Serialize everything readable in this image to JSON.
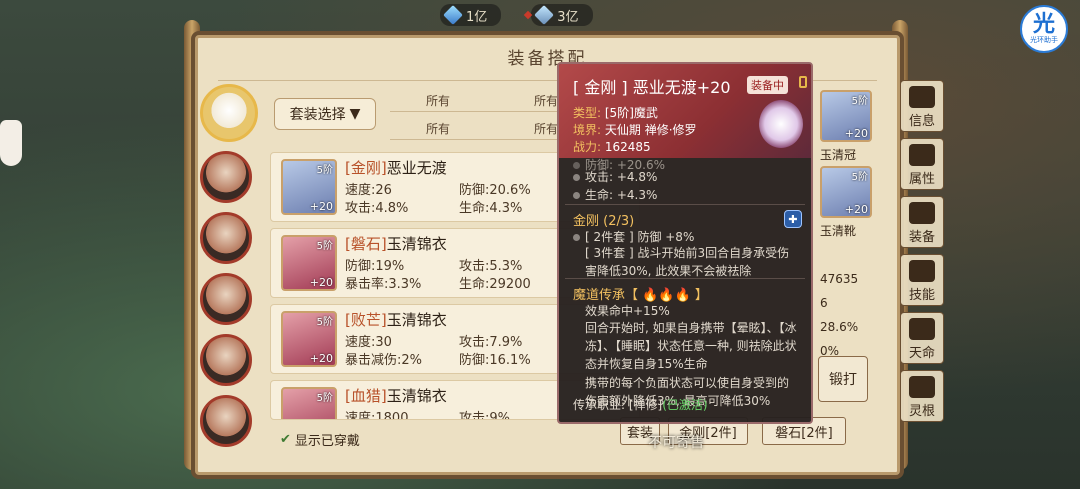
{
  "currency": {
    "jade": "1亿",
    "spirit_stone": "3亿"
  },
  "logo": {
    "big": "光",
    "small": "光环助手"
  },
  "panel": {
    "title": "装备搭配"
  },
  "filters": {
    "suit_select": "套装选择",
    "filter_all": "所有"
  },
  "rows": [
    {
      "tag": "[金刚]",
      "name": "恶业无渡",
      "tier": "5阶",
      "plus": "+20",
      "s1": "速度:26",
      "s2": "防御:20.6%",
      "s3": "攻击:4.8%",
      "s4": "生命:4.3%"
    },
    {
      "tag": "[磐石]",
      "name": "玉清锦衣",
      "tier": "5阶",
      "plus": "+20",
      "s1": "防御:19%",
      "s2": "攻击:5.3%",
      "s3": "暴击率:3.3%",
      "s4": "生命:29200"
    },
    {
      "tag": "[败芒]",
      "name": "玉清锦衣",
      "tier": "5阶",
      "plus": "+20",
      "s1": "速度:30",
      "s2": "攻击:7.9%",
      "s3": "暴击减伤:2%",
      "s4": "防御:16.1%"
    },
    {
      "tag": "[血猎]",
      "name": "玉清锦衣",
      "tier": "5阶",
      "plus": "",
      "s1": "速度:1800",
      "s2": "攻击:9%",
      "s3": "",
      "s4": ""
    }
  ],
  "show_worn": "显示已穿戴",
  "right_column": {
    "slot1_tier": "5阶",
    "slot1_plus": "+20",
    "slot1_label": "玉清冠",
    "slot2_tier": "5阶",
    "slot2_plus": "+20",
    "slot2_label": "玉清靴",
    "v1": "47635",
    "v2": "6",
    "v3": "28.6%",
    "v4": "0%"
  },
  "forge_button": "锻打",
  "tabs": [
    "信息",
    "属性",
    "装备",
    "技能",
    "天命",
    "灵根"
  ],
  "bottom_tabs": {
    "t1": "套装",
    "t2": "金刚[2件]",
    "t3": "磐石[2件]"
  },
  "tooltip": {
    "name": "[ 金刚 ] 恶业无渡+20",
    "badge": "装备中",
    "type_key": "类型:",
    "type_val": "[5阶]魔武",
    "realm_key": "境界:",
    "realm_val": "天仙期 禅修·修罗",
    "power_key": "战力:",
    "power_val": "162485",
    "stat_defense": "防御: +20.6%",
    "stat_attack": "攻击: +4.8%",
    "stat_life": "生命: +4.3%",
    "set_title": "金刚 (2/3)",
    "set_2": "[ 2件套 ] 防御 +8%",
    "set_3": "[ 3件套 ] 战斗开始前3回合自身承受伤害降低30%, 此效果不会被祛除",
    "inherit_title": "魔道传承【",
    "inherit_flames": "🔥🔥🔥",
    "inherit_close": "】",
    "eff1": "效果命中+15%",
    "eff2": "回合开始时, 如果自身携带【晕眩】、【冰冻】、【睡眠】状态任意一种, 则祛除此状态并恢复自身15%生命",
    "eff3": "携带的每个负面状态可以使自身受到的伤害额外降低3%, 最高可降低30%",
    "job_key": "传承职业: [禅修]",
    "job_status": "(已激活)"
  },
  "consign": "不可寄售",
  "colors": {
    "accent_red": "#8c2f33",
    "gold": "#f2c060",
    "active_green": "#6ad66a",
    "set_blue": "#8ab4ff"
  }
}
